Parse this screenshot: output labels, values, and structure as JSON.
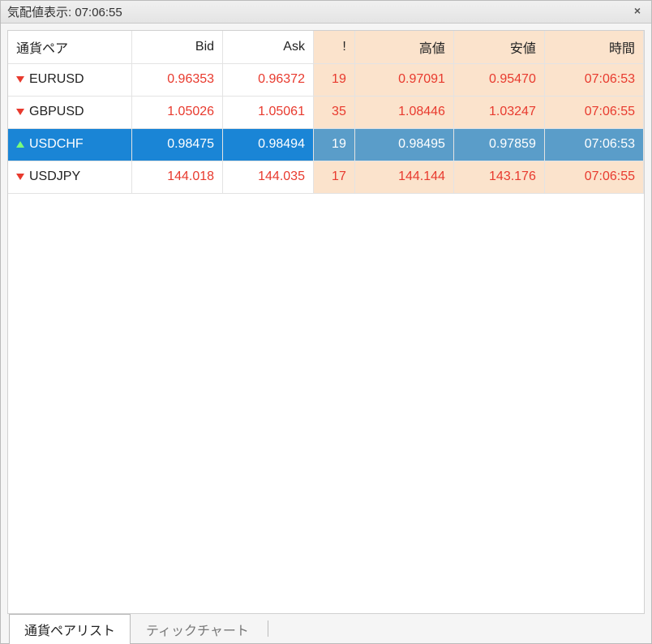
{
  "window": {
    "title": "気配値表示: 07:06:55"
  },
  "columns": {
    "pair": "通貨ペア",
    "bid": "Bid",
    "ask": "Ask",
    "spread": "!",
    "high": "高値",
    "low": "安値",
    "time": "時間"
  },
  "rows": [
    {
      "dir": "down",
      "pair": "EURUSD",
      "bid": "0.96353",
      "ask": "0.96372",
      "spread": "19",
      "high": "0.97091",
      "low": "0.95470",
      "time": "07:06:53",
      "selected": false
    },
    {
      "dir": "down",
      "pair": "GBPUSD",
      "bid": "1.05026",
      "ask": "1.05061",
      "spread": "35",
      "high": "1.08446",
      "low": "1.03247",
      "time": "07:06:55",
      "selected": false
    },
    {
      "dir": "up",
      "pair": "USDCHF",
      "bid": "0.98475",
      "ask": "0.98494",
      "spread": "19",
      "high": "0.98495",
      "low": "0.97859",
      "time": "07:06:53",
      "selected": true
    },
    {
      "dir": "down",
      "pair": "USDJPY",
      "bid": "144.018",
      "ask": "144.035",
      "spread": "17",
      "high": "144.144",
      "low": "143.176",
      "time": "07:06:55",
      "selected": false
    }
  ],
  "tabs": {
    "pairlist": "通貨ペアリスト",
    "tickchart": "ティックチャート"
  }
}
